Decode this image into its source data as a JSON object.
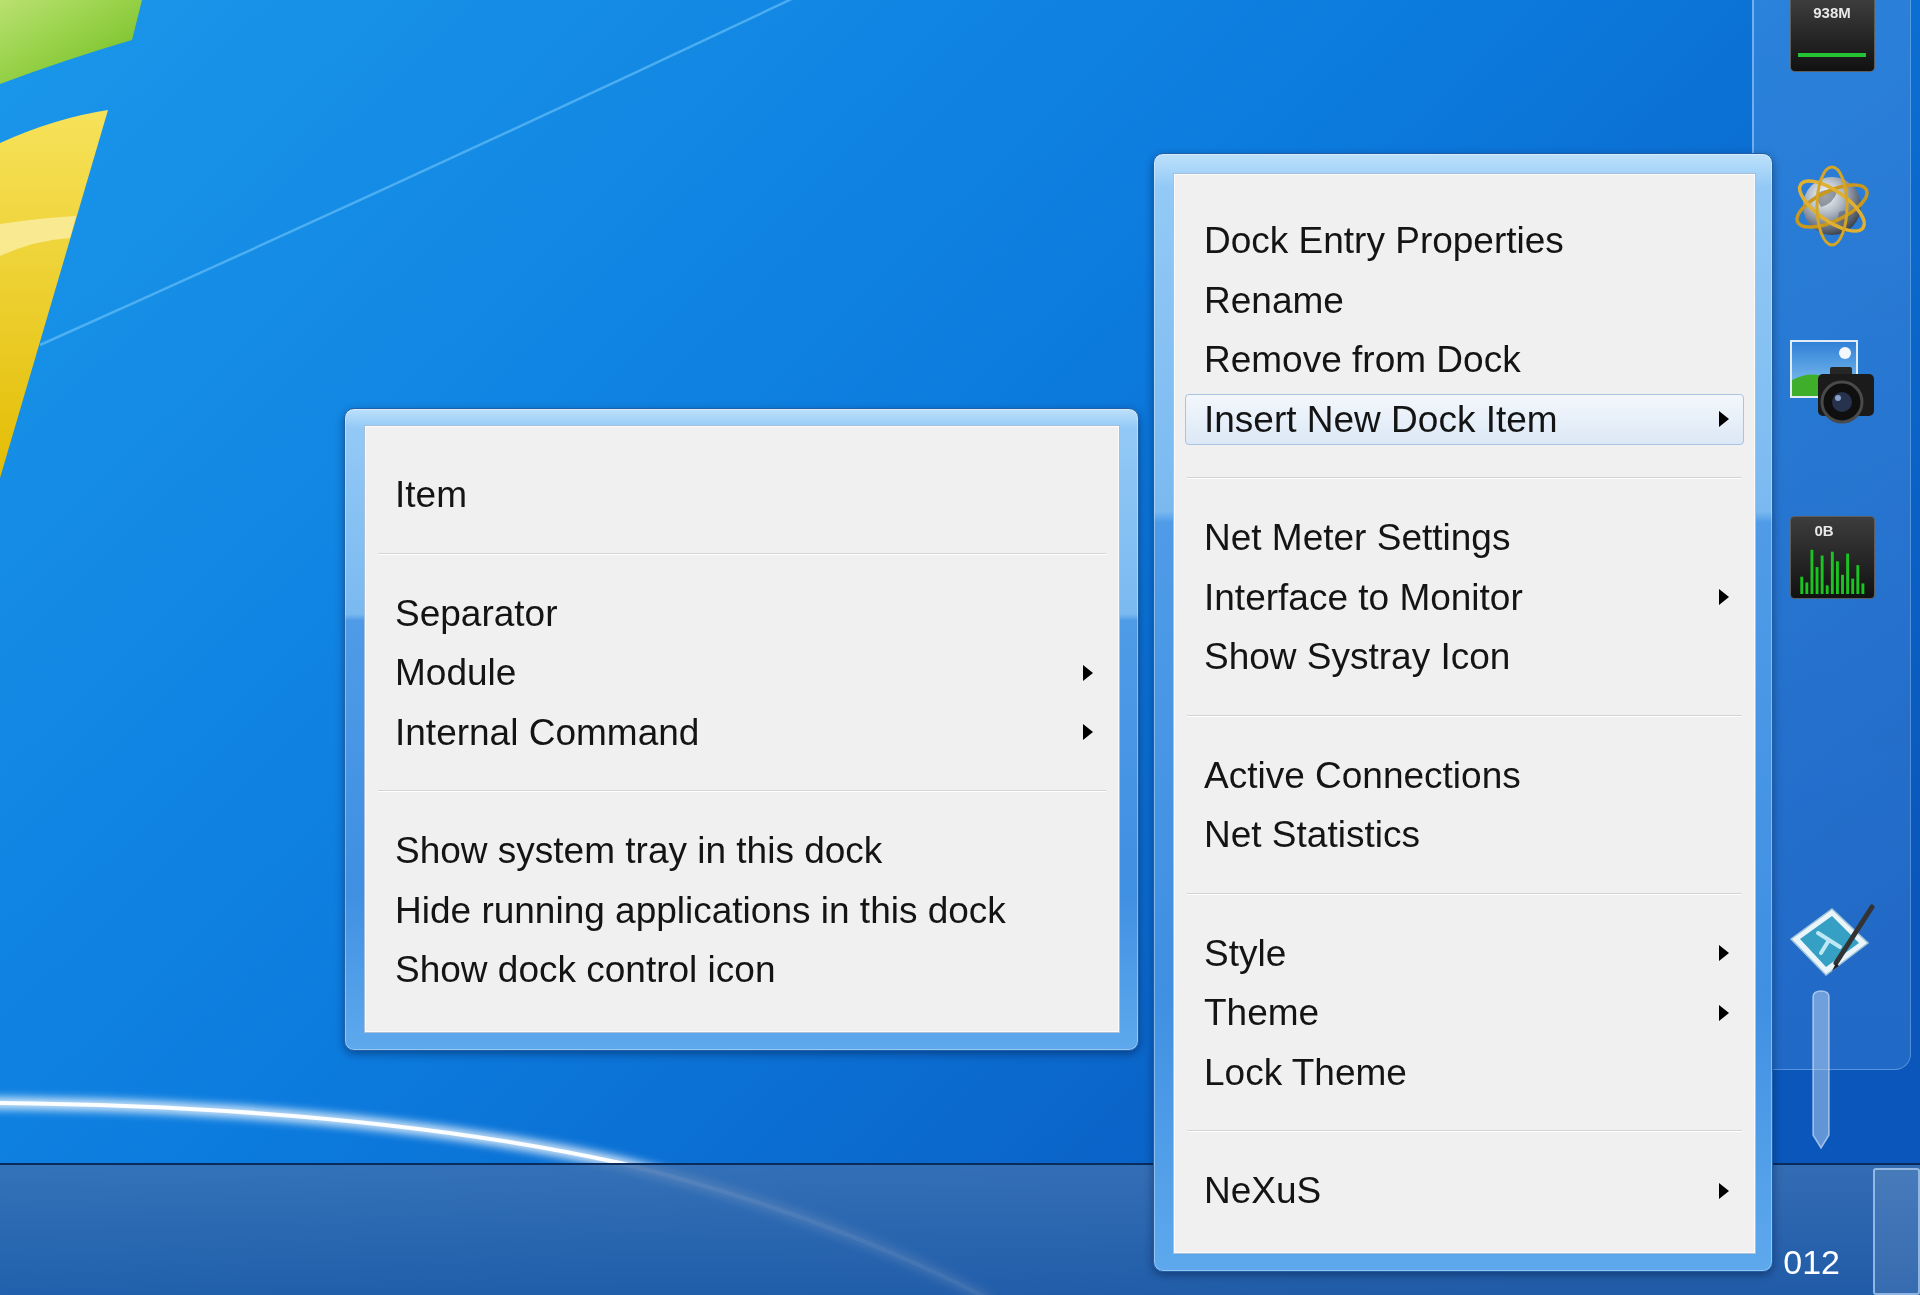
{
  "dock": {
    "items": [
      {
        "kind": "meter",
        "reading": "938M"
      },
      {
        "kind": "globe"
      },
      {
        "kind": "camera"
      },
      {
        "kind": "graph",
        "reading": "0B"
      },
      {
        "kind": "tablet"
      }
    ]
  },
  "dock_menu": {
    "groups": [
      {
        "items": [
          {
            "label": "Dock Entry Properties",
            "submenu": false,
            "selected": false
          },
          {
            "label": "Rename",
            "submenu": false,
            "selected": false
          },
          {
            "label": "Remove from Dock",
            "submenu": false,
            "selected": false
          },
          {
            "label": "Insert New Dock Item",
            "submenu": true,
            "selected": true
          }
        ]
      },
      {
        "items": [
          {
            "label": "Net Meter Settings",
            "submenu": false,
            "selected": false
          },
          {
            "label": "Interface to Monitor",
            "submenu": true,
            "selected": false
          },
          {
            "label": "Show Systray Icon",
            "submenu": false,
            "selected": false
          }
        ]
      },
      {
        "items": [
          {
            "label": "Active Connections",
            "submenu": false,
            "selected": false
          },
          {
            "label": "Net Statistics",
            "submenu": false,
            "selected": false
          }
        ]
      },
      {
        "items": [
          {
            "label": "Style",
            "submenu": true,
            "selected": false
          },
          {
            "label": "Theme",
            "submenu": true,
            "selected": false
          },
          {
            "label": "Lock Theme",
            "submenu": false,
            "selected": false
          }
        ]
      },
      {
        "items": [
          {
            "label": "NeXuS",
            "submenu": true,
            "selected": false
          }
        ]
      }
    ]
  },
  "insert_submenu": {
    "groups": [
      {
        "items": [
          {
            "label": "Item",
            "submenu": false,
            "selected": false
          }
        ]
      },
      {
        "items": [
          {
            "label": "Separator",
            "submenu": false,
            "selected": false
          },
          {
            "label": "Module",
            "submenu": true,
            "selected": false
          },
          {
            "label": "Internal Command",
            "submenu": true,
            "selected": false
          }
        ]
      },
      {
        "items": [
          {
            "label": "Show system tray in this dock",
            "submenu": false,
            "selected": false
          },
          {
            "label": "Hide running applications in this dock",
            "submenu": false,
            "selected": false
          },
          {
            "label": "Show dock control icon",
            "submenu": false,
            "selected": false
          }
        ]
      }
    ]
  },
  "taskbar": {
    "clock": "012"
  }
}
